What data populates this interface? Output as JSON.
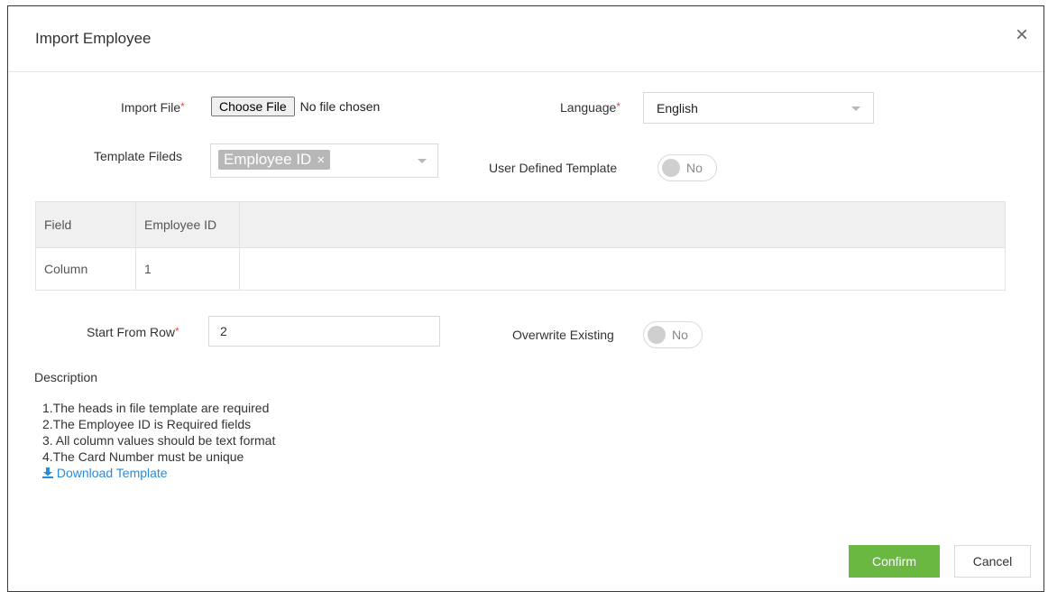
{
  "dialog": {
    "title": "Import Employee",
    "close_glyph": "×"
  },
  "import_file": {
    "label": "Import File",
    "required_mark": "*",
    "button_label": "Choose File",
    "status": "No file chosen"
  },
  "language": {
    "label": "Language",
    "required_mark": "*",
    "value": "English"
  },
  "template_fields": {
    "label": "Template Fileds",
    "chip_label": "Employee ID",
    "chip_remove": "×"
  },
  "user_defined_template": {
    "label": "User Defined Template",
    "state": "No"
  },
  "mapping_table": {
    "rows": [
      {
        "name": "Field",
        "value": "Employee ID"
      },
      {
        "name": "Column",
        "value": "1"
      }
    ]
  },
  "start_from_row": {
    "label": "Start From Row",
    "required_mark": "*",
    "value": "2"
  },
  "overwrite_existing": {
    "label": "Overwrite Existing",
    "state": "No"
  },
  "description": {
    "title": "Description",
    "lines": [
      "1.The heads in file template are required",
      "2.The Employee ID is Required fields",
      "3. All column values should be text format",
      "4.The Card Number must be unique"
    ],
    "download_link": "Download Template"
  },
  "footer": {
    "confirm_label": "Confirm",
    "cancel_label": "Cancel"
  },
  "colors": {
    "confirm": "#6ab841",
    "link": "#2a8bd8",
    "required": "#e74c3c"
  },
  "icons": {
    "close": "close-icon",
    "download": "download-icon",
    "dropdown": "chevron-down-icon"
  }
}
